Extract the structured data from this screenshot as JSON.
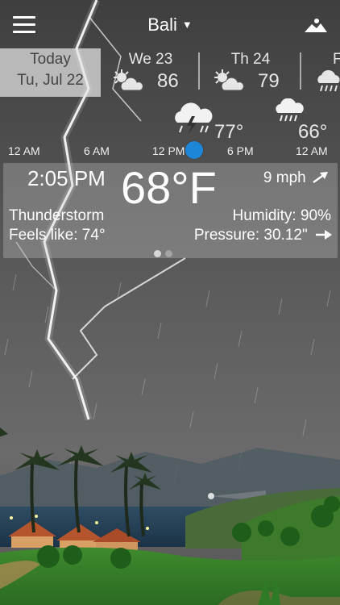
{
  "header": {
    "location": "Bali",
    "caret": "▼"
  },
  "days": [
    {
      "name": "Today",
      "date": "Tu, Jul 22"
    },
    {
      "name": "We 23",
      "temp": "86",
      "icon": "partly-cloudy-icon"
    },
    {
      "name": "Th 24",
      "temp": "79",
      "icon": "partly-cloudy-icon"
    },
    {
      "name": "F",
      "icon": "rain-cloud-icon"
    }
  ],
  "hourly": {
    "labels": [
      "12 AM",
      "6 AM",
      "12 PM",
      "6 PM",
      "12 AM"
    ],
    "points": [
      {
        "temp": "77°",
        "icon": "thunderstorm-icon"
      },
      {
        "temp": "66°",
        "icon": "rain-cloud-icon"
      }
    ]
  },
  "current": {
    "time": "2:05 PM",
    "temperature": "68°F",
    "wind": "9 mph",
    "condition": "Thunderstorm",
    "feels_like": "Feels like: 74°",
    "humidity": "Humidity: 90%",
    "pressure": "Pressure: 30.12\""
  },
  "colors": {
    "accent_dot": "#1e86d6",
    "today_tab_bg": "#e6e6e6"
  }
}
